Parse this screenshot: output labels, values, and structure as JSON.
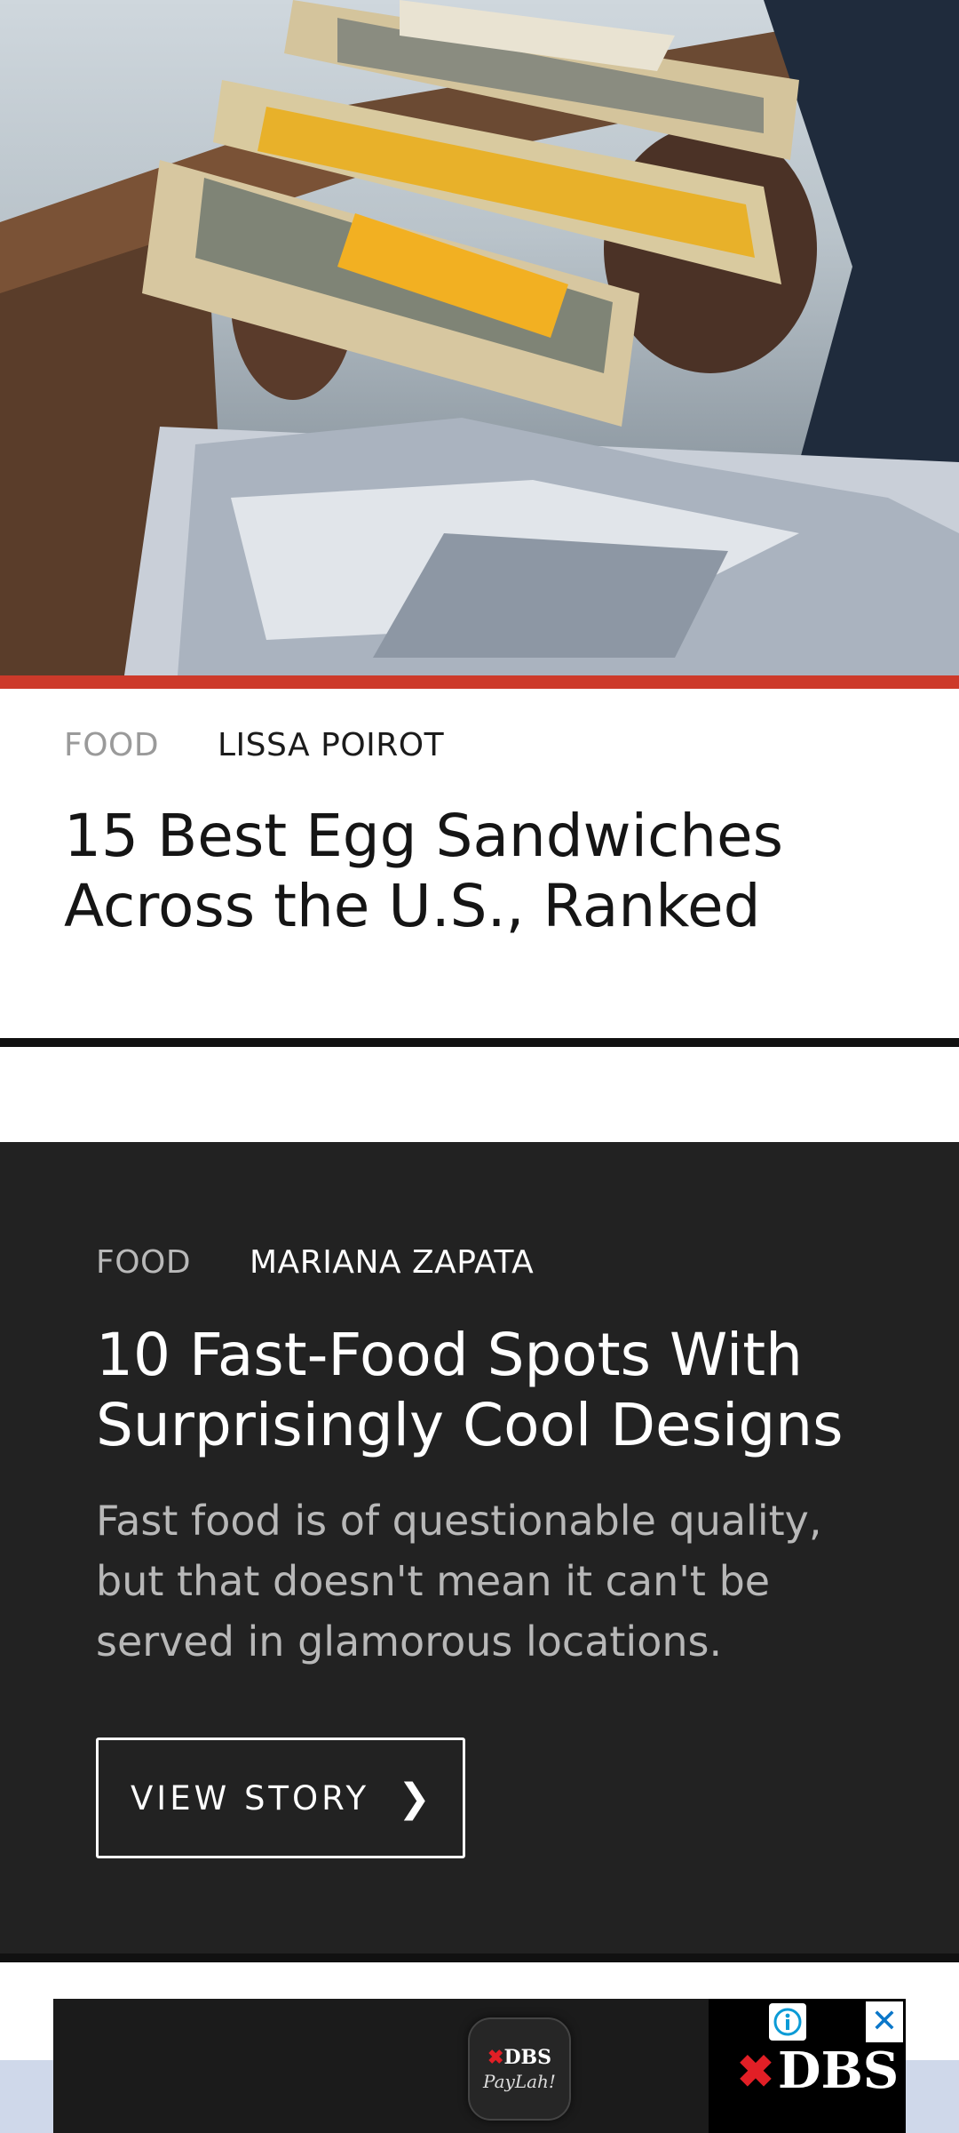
{
  "article1": {
    "category": "FOOD",
    "author": "LISSA POIROT",
    "title": "15 Best Egg Sandwiches Across the U.S., Ranked"
  },
  "article2": {
    "category": "FOOD",
    "author": "MARIANA ZAPATA",
    "title": "10 Fast-Food Spots With Surprisingly Cool Designs",
    "description": "Fast food is of questionable quality, but that doesn't mean it can't be served in glamorous locations.",
    "button_label": "VIEW STORY",
    "button_icon": "chevron-right-icon"
  },
  "ad": {
    "app_brand": "DBS",
    "app_tagline": "PayLah!",
    "brand_logo": "DBS",
    "info_icon": "adchoices-info-icon",
    "close_icon": "close-icon",
    "close_glyph": "✕"
  },
  "colors": {
    "accent": "#cd3a2a",
    "dark_card": "#222222",
    "brand_red": "#e21f26",
    "ad_close_blue": "#0b77c9"
  }
}
